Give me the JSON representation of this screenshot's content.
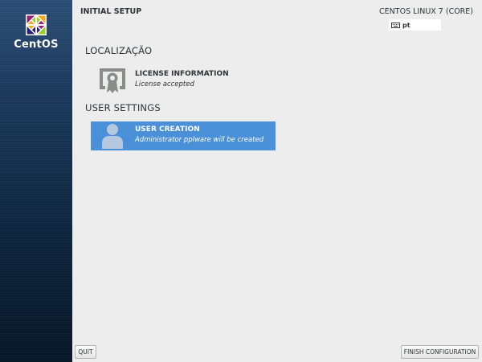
{
  "sidebar": {
    "logo_text": "CentOS"
  },
  "header": {
    "title": "INITIAL SETUP",
    "product": "CENTOS LINUX 7 (CORE)",
    "keyboard_layout": "pt"
  },
  "sections": [
    {
      "title": "LOCALIZAÇÃO",
      "spokes": [
        {
          "name": "LICENSE INFORMATION",
          "status": "License accepted",
          "icon": "license-certificate-icon"
        }
      ]
    },
    {
      "title": "USER SETTINGS",
      "spokes": [
        {
          "name": "USER CREATION",
          "status": "Administrator pplware will be created",
          "icon": "user-icon",
          "selected": true
        }
      ]
    }
  ],
  "buttons": {
    "quit": "QUIT",
    "finish": "FINISH CONFIGURATION"
  },
  "colors": {
    "sidebar": "#1c3a5c",
    "background": "#ededed",
    "selected": "#4a90d9"
  }
}
